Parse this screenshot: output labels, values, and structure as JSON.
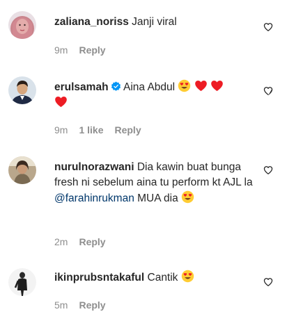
{
  "comments": [
    {
      "username": "zaliana_noriss",
      "text": "Janji viral",
      "time": "9m",
      "reply_label": "Reply",
      "avatar_icon": "avatar-woman-hijab"
    },
    {
      "username": "erulsamah",
      "verified": true,
      "text": "Aina Abdul",
      "emojis": [
        "heart-eyes-emoji",
        "red-heart-emoji",
        "red-heart-emoji",
        "red-heart-emoji"
      ],
      "time": "9m",
      "likes": "1 like",
      "reply_label": "Reply",
      "avatar_icon": "avatar-man-suit"
    },
    {
      "username": "nurulnorazwani",
      "text_before": "Dia kawin buat bunga fresh ni sebelum aina tu perform kt AJL la",
      "mention": "@farahinrukman",
      "text_after": "MUA dia",
      "emojis": [
        "heart-eyes-emoji"
      ],
      "time": "2m",
      "reply_label": "Reply",
      "avatar_icon": "avatar-woman"
    },
    {
      "username": "ikinprubsntakaful",
      "text": "Cantik",
      "emojis": [
        "heart-eyes-emoji"
      ],
      "time": "5m",
      "reply_label": "Reply",
      "avatar_icon": "avatar-person-standing"
    }
  ],
  "colors": {
    "text": "#262626",
    "meta": "#8e8e8e",
    "mention": "#00376b",
    "verified": "#0095f6",
    "heart_red": "#ed1c24",
    "emoji_yellow": "#ffcc33"
  }
}
